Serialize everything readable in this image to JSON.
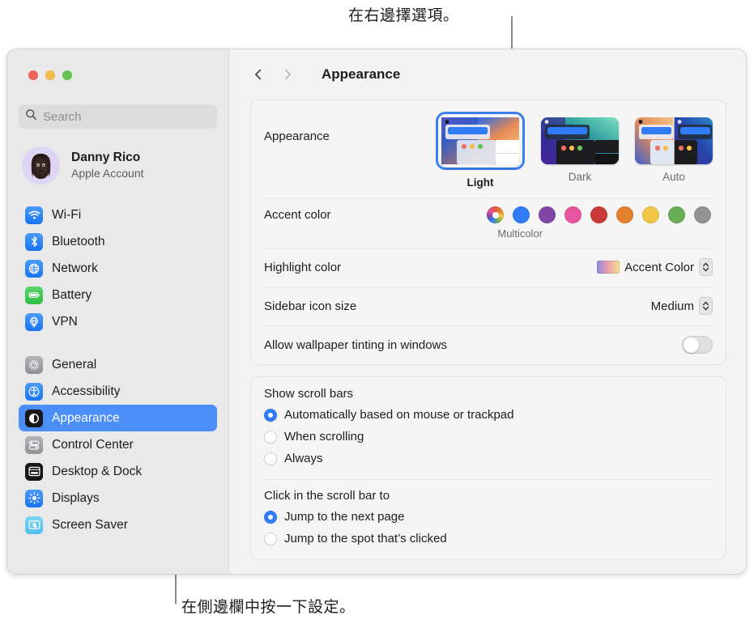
{
  "annotations": {
    "top": "在右邊擇選項。",
    "bottom": "在側邊欄中按一下設定。"
  },
  "window": {
    "traffic_lights": [
      "close",
      "minimize",
      "zoom"
    ],
    "toolbar": {
      "back_icon": "chevron-left-icon",
      "forward_icon": "chevron-right-icon",
      "title": "Appearance"
    }
  },
  "sidebar": {
    "search": {
      "placeholder": "Search",
      "value": "",
      "icon": "search-icon"
    },
    "account": {
      "name": "Danny Rico",
      "subtitle": "Apple Account"
    },
    "groups": [
      {
        "items": [
          {
            "label": "Wi-Fi",
            "icon": "wifi-icon",
            "selected": false
          },
          {
            "label": "Bluetooth",
            "icon": "bluetooth-icon",
            "selected": false
          },
          {
            "label": "Network",
            "icon": "network-icon",
            "selected": false
          },
          {
            "label": "Battery",
            "icon": "battery-icon",
            "selected": false
          },
          {
            "label": "VPN",
            "icon": "vpn-icon",
            "selected": false
          }
        ]
      },
      {
        "items": [
          {
            "label": "General",
            "icon": "general-gear-icon",
            "selected": false
          },
          {
            "label": "Accessibility",
            "icon": "accessibility-icon",
            "selected": false
          },
          {
            "label": "Appearance",
            "icon": "appearance-icon",
            "selected": true
          },
          {
            "label": "Control Center",
            "icon": "control-center-icon",
            "selected": false
          },
          {
            "label": "Desktop & Dock",
            "icon": "desktop-dock-icon",
            "selected": false
          },
          {
            "label": "Displays",
            "icon": "displays-icon",
            "selected": false
          },
          {
            "label": "Screen Saver",
            "icon": "screen-saver-icon",
            "selected": false
          }
        ]
      }
    ]
  },
  "main": {
    "appearance": {
      "label": "Appearance",
      "options": [
        {
          "label": "Light",
          "selected": true
        },
        {
          "label": "Dark",
          "selected": false
        },
        {
          "label": "Auto",
          "selected": false
        }
      ]
    },
    "accent_color": {
      "label": "Accent color",
      "caption": "Multicolor",
      "swatches": [
        {
          "name": "multicolor",
          "color": "multicolor",
          "selected": true
        },
        {
          "name": "blue",
          "color": "#2f7cf6"
        },
        {
          "name": "purple",
          "color": "#8145a8"
        },
        {
          "name": "pink",
          "color": "#e8559f"
        },
        {
          "name": "red",
          "color": "#c73a38"
        },
        {
          "name": "orange",
          "color": "#e4812c"
        },
        {
          "name": "yellow",
          "color": "#f2c747"
        },
        {
          "name": "green",
          "color": "#68ae55"
        },
        {
          "name": "graphite",
          "color": "#939393"
        }
      ]
    },
    "highlight_color": {
      "label": "Highlight color",
      "value": "Accent Color"
    },
    "sidebar_icon_size": {
      "label": "Sidebar icon size",
      "value": "Medium"
    },
    "wallpaper_tinting": {
      "label": "Allow wallpaper tinting in windows",
      "enabled": false
    },
    "show_scroll_bars": {
      "title": "Show scroll bars",
      "options": [
        {
          "label": "Automatically based on mouse or trackpad",
          "selected": true
        },
        {
          "label": "When scrolling",
          "selected": false
        },
        {
          "label": "Always",
          "selected": false
        }
      ]
    },
    "click_scroll_bar": {
      "title": "Click in the scroll bar to",
      "options": [
        {
          "label": "Jump to the next page",
          "selected": true
        },
        {
          "label": "Jump to the spot that’s clicked",
          "selected": false
        }
      ]
    }
  }
}
